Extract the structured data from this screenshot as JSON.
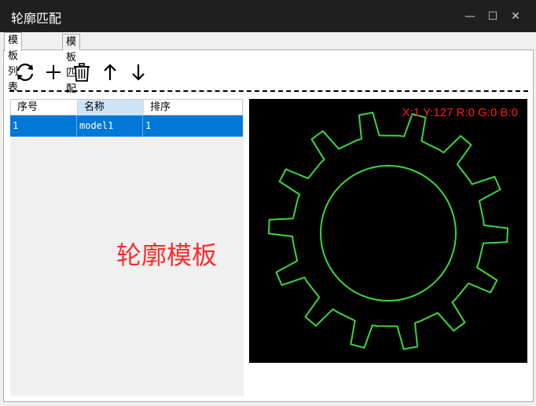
{
  "window": {
    "title": "轮廓匹配",
    "minimize_glyph": "—",
    "maximize_glyph": "☐",
    "close_glyph": "✕"
  },
  "tabs": [
    {
      "label": "模板列表",
      "active": true
    },
    {
      "label": "模板匹配",
      "active": false
    }
  ],
  "toolbar": {
    "icons": [
      "refresh-icon",
      "add-icon",
      "delete-icon",
      "move-up-icon",
      "move-down-icon"
    ]
  },
  "table": {
    "columns": [
      "序号",
      "名称",
      "排序"
    ],
    "rows": [
      {
        "index": "1",
        "name": "model1",
        "order": "1",
        "selected": true
      }
    ]
  },
  "overlay_label": "轮廓模板",
  "viewer": {
    "readout": "X:1 Y:127  R:0 G:0 B:0",
    "contour_color": "#3dd63d",
    "gear_teeth": 14
  },
  "colors": {
    "selection": "#0078d7",
    "label_red": "#ff2b2b",
    "titlebar": "#1f1f1f"
  }
}
